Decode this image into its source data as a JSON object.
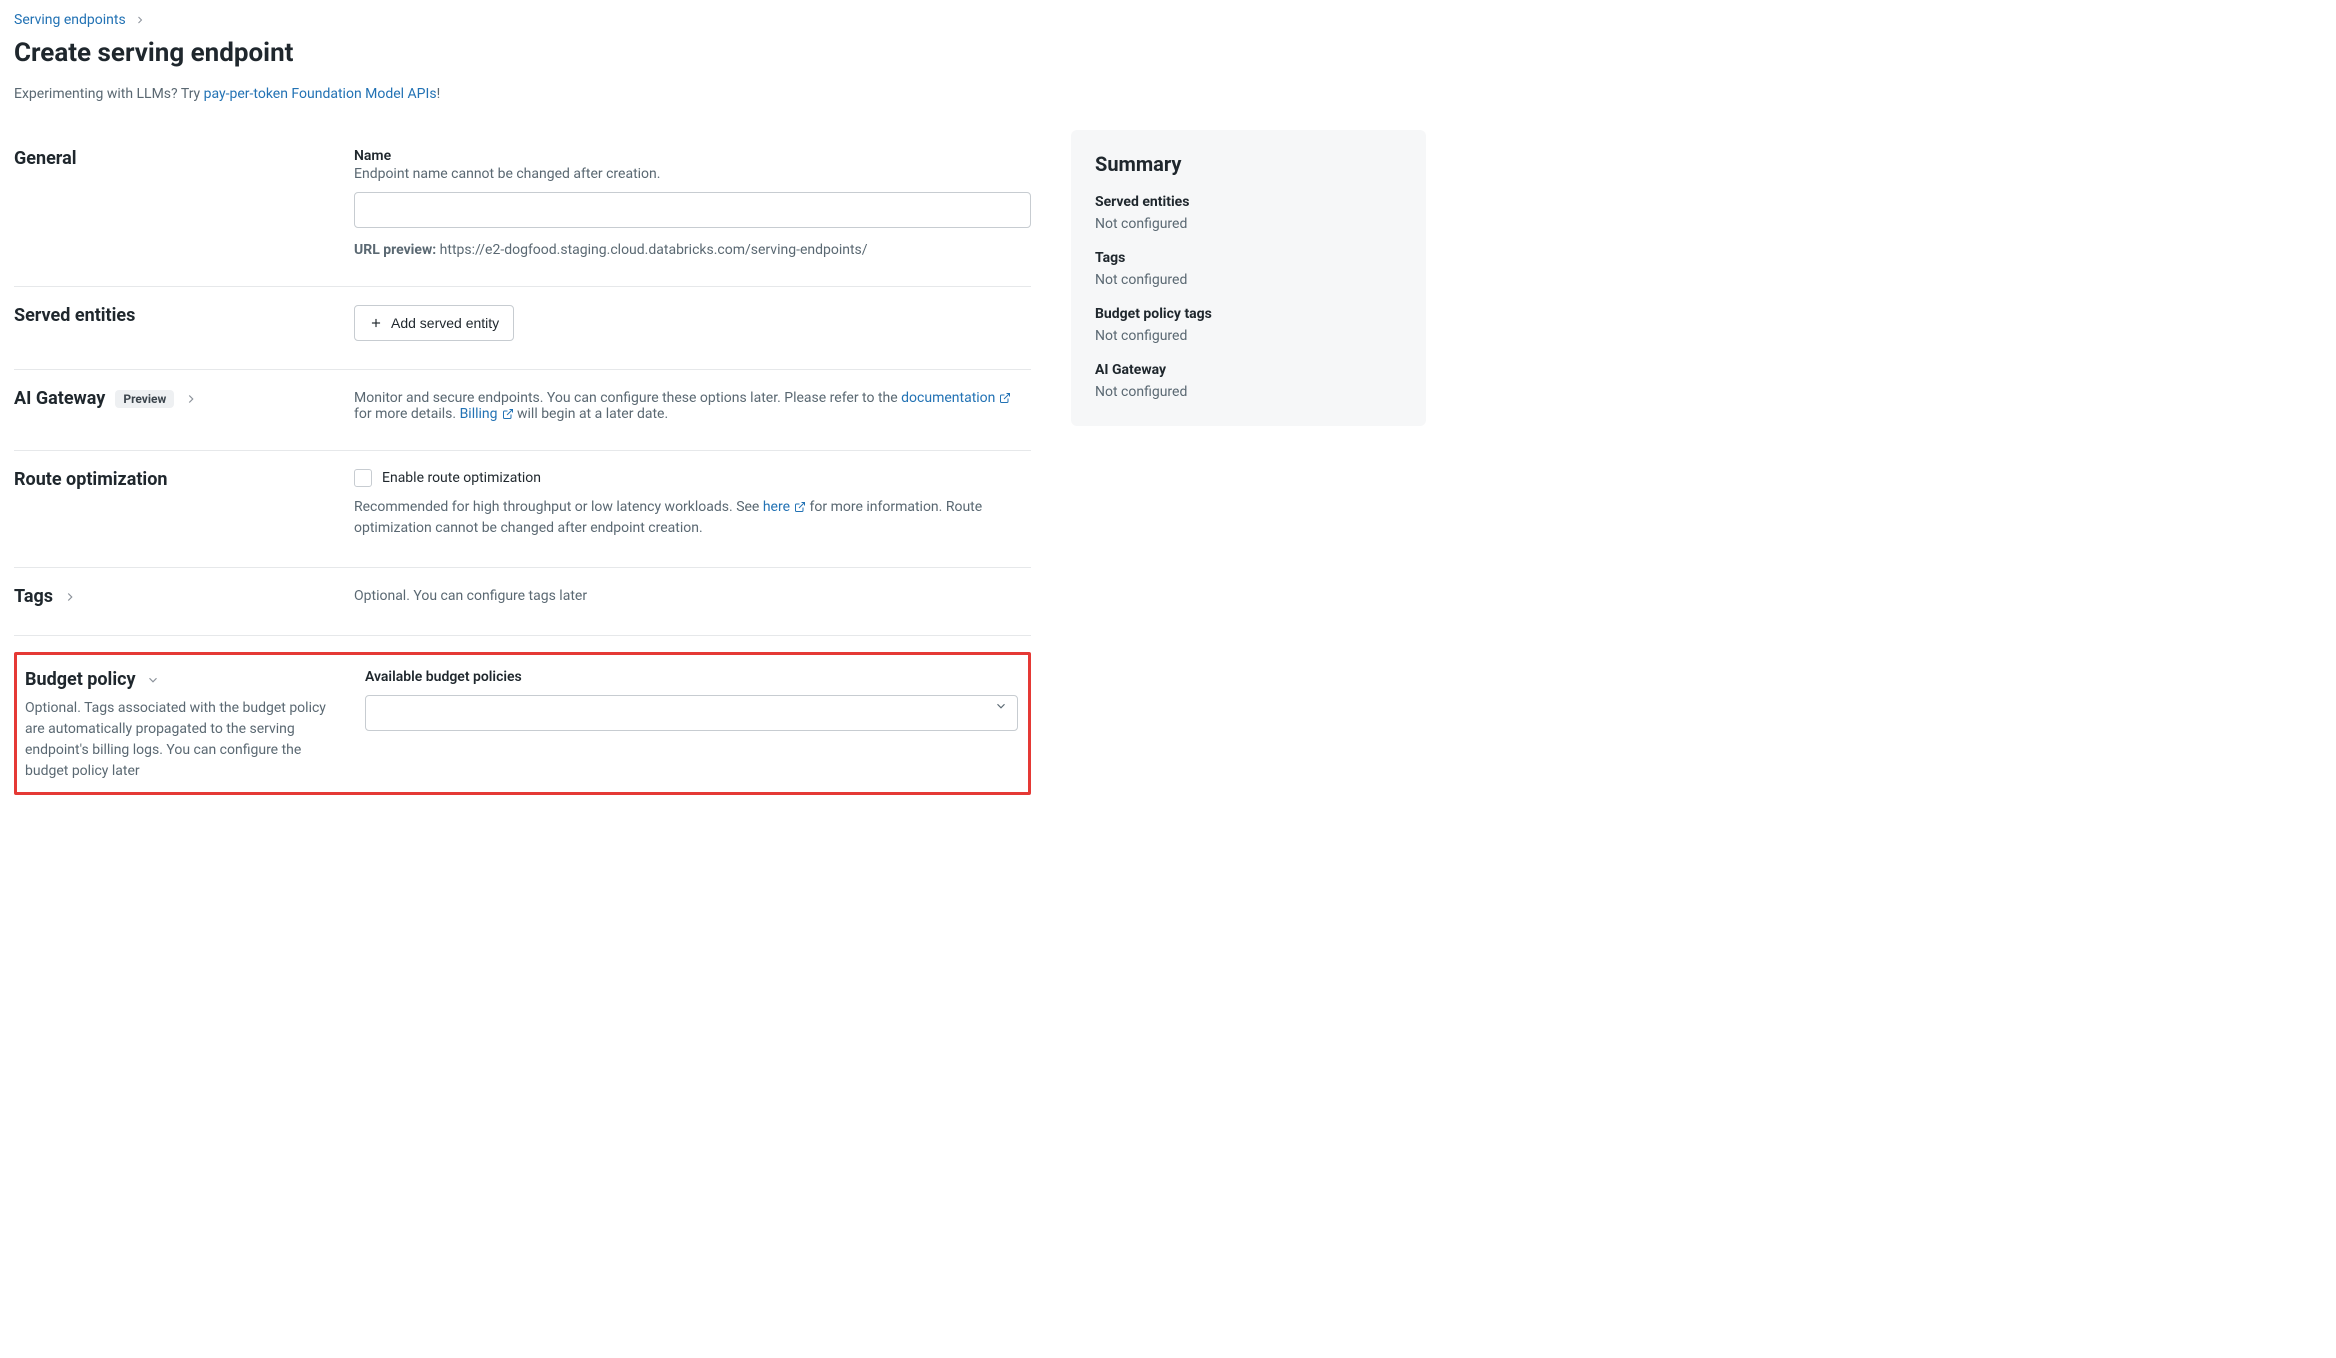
{
  "breadcrumb": {
    "parent": "Serving endpoints"
  },
  "page_title": "Create serving endpoint",
  "sub": {
    "prefix": "Experimenting with LLMs? Try ",
    "link": "pay-per-token Foundation Model APIs",
    "suffix": "!"
  },
  "general": {
    "heading": "General",
    "name_label": "Name",
    "name_hint": "Endpoint name cannot be changed after creation.",
    "url_label": "URL preview:",
    "url_value": "https://e2-dogfood.staging.cloud.databricks.com/serving-endpoints/"
  },
  "served": {
    "heading": "Served entities",
    "add_button": "Add served entity"
  },
  "ai_gateway": {
    "heading": "AI Gateway",
    "badge": "Preview",
    "desc_pre": "Monitor and secure endpoints. You can configure these options later. Please refer to the ",
    "doc_link": "documentation",
    "desc_mid": " for more details. ",
    "billing_link": "Billing",
    "desc_post": " will begin at a later date."
  },
  "route": {
    "heading": "Route optimization",
    "checkbox_label": "Enable route optimization",
    "desc_pre": "Recommended for high throughput or low latency workloads. See ",
    "here_link": "here",
    "desc_post": " for more information. Route optimization cannot be changed after endpoint creation."
  },
  "tags": {
    "heading": "Tags",
    "desc": "Optional. You can configure tags later"
  },
  "budget": {
    "heading": "Budget policy",
    "sub": "Optional. Tags associated with the budget policy are automatically propagated to the serving endpoint's billing logs. You can configure the budget policy later",
    "field_label": "Available budget policies"
  },
  "summary": {
    "heading": "Summary",
    "items": [
      {
        "title": "Served entities",
        "value": "Not configured"
      },
      {
        "title": "Tags",
        "value": "Not configured"
      },
      {
        "title": "Budget policy tags",
        "value": "Not configured"
      },
      {
        "title": "AI Gateway",
        "value": "Not configured"
      }
    ]
  }
}
